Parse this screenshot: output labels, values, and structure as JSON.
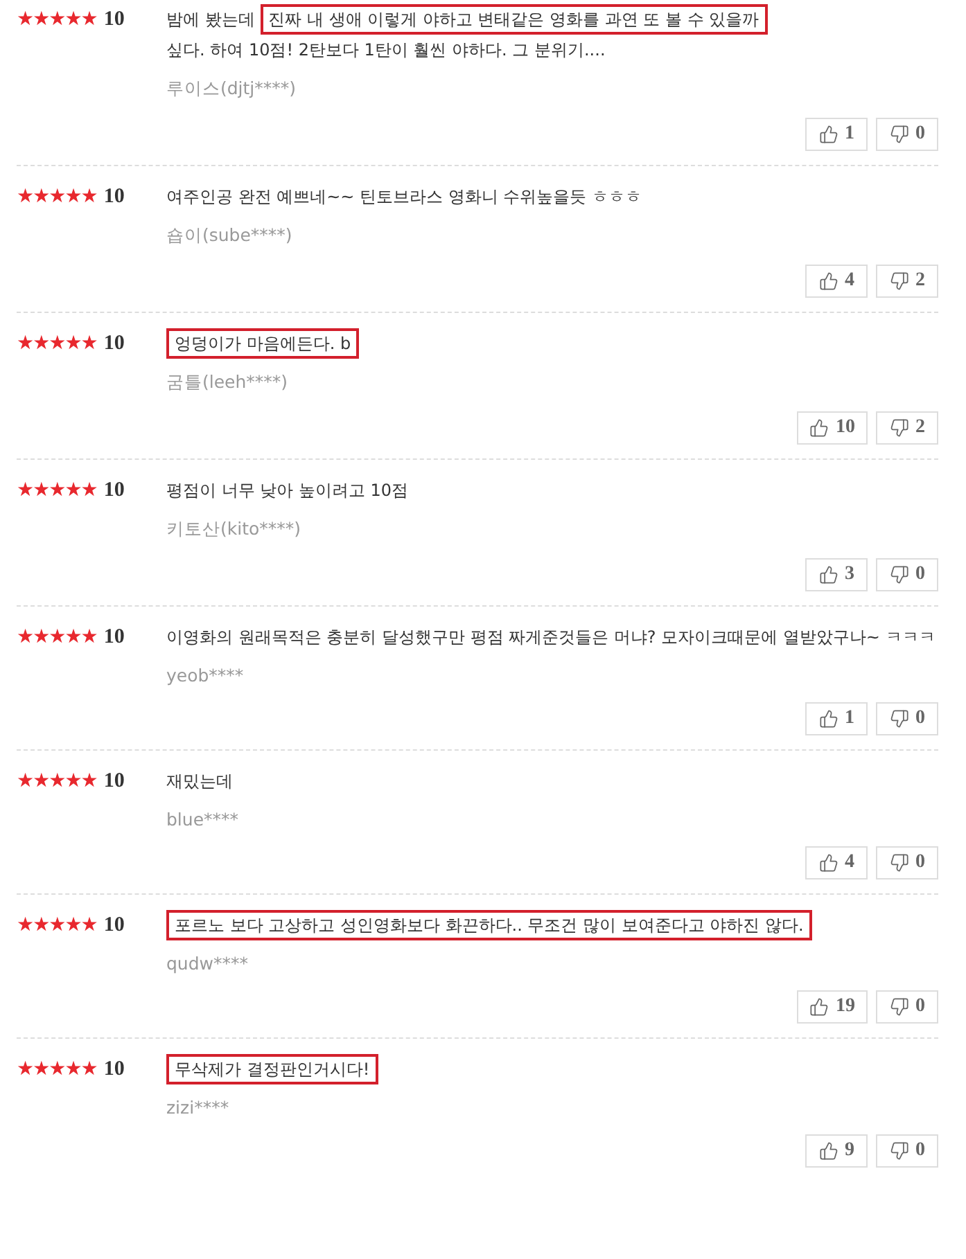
{
  "reviews": [
    {
      "stars": 5,
      "score": "10",
      "segments": [
        {
          "text": "밤에 봤는데",
          "boxed": false,
          "new_line": false
        },
        {
          "text": "진짜 내 생애 이렇게 야하고 변태같은 영화를 과연 또 볼 수 있을까",
          "boxed": true,
          "new_line": false
        },
        {
          "text": "싶다. 하여 10점! 2탄보다 1탄이 훨씬 야하다. 그 분위기....",
          "boxed": false,
          "new_line": true
        }
      ],
      "author": "루이스(djtj****)",
      "likes": "1",
      "dislikes": "0"
    },
    {
      "stars": 5,
      "score": "10",
      "segments": [
        {
          "text": "여주인공 완전 예쁘네~~ 틴토브라스 영화니 수위높을듯 ㅎㅎㅎ",
          "boxed": false,
          "new_line": false
        }
      ],
      "author": "숍이(sube****)",
      "likes": "4",
      "dislikes": "2"
    },
    {
      "stars": 5,
      "score": "10",
      "segments": [
        {
          "text": "엉덩이가 마음에든다. b",
          "boxed": true,
          "new_line": false
        }
      ],
      "author": "굼틀(leeh****)",
      "likes": "10",
      "dislikes": "2"
    },
    {
      "stars": 5,
      "score": "10",
      "segments": [
        {
          "text": "평점이 너무 낮아 높이려고 10점",
          "boxed": false,
          "new_line": false
        }
      ],
      "author": "키토산(kito****)",
      "likes": "3",
      "dislikes": "0"
    },
    {
      "stars": 5,
      "score": "10",
      "segments": [
        {
          "text": "이영화의 원래목적은 충분히 달성했구만 평점 짜게준것들은 머냐? 모자이크때문에 열받았구나~ ㅋㅋㅋ",
          "boxed": false,
          "new_line": false
        }
      ],
      "author": "yeob****",
      "likes": "1",
      "dislikes": "0"
    },
    {
      "stars": 5,
      "score": "10",
      "segments": [
        {
          "text": "재밌는데",
          "boxed": false,
          "new_line": false
        }
      ],
      "author": "blue****",
      "likes": "4",
      "dislikes": "0"
    },
    {
      "stars": 5,
      "score": "10",
      "segments": [
        {
          "text": "포르노 보다 고상하고 성인영화보다 화끈하다.. 무조건 많이 보여준다고 야하진 않다.",
          "boxed": true,
          "new_line": false
        }
      ],
      "author": "qudw****",
      "likes": "19",
      "dislikes": "0"
    },
    {
      "stars": 5,
      "score": "10",
      "segments": [
        {
          "text": "무삭제가 결정판인거시다!",
          "boxed": true,
          "new_line": false
        }
      ],
      "author": "zizi****",
      "likes": "9",
      "dislikes": "0"
    }
  ]
}
